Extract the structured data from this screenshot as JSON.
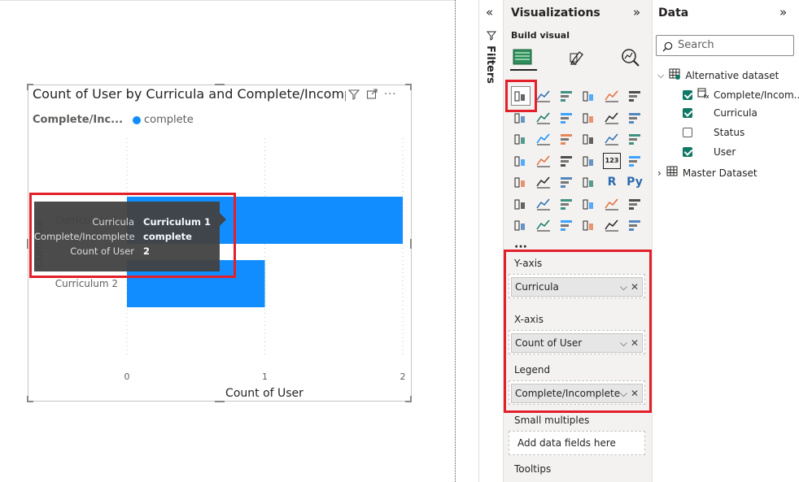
{
  "visual": {
    "title": "Count of User by Curricula and Complete/Incomplete",
    "legend_title": "Complete/Inc...",
    "legend_item": "complete",
    "icons": [
      "filter-icon",
      "focus-mode-icon",
      "more-options-icon"
    ]
  },
  "chart_data": {
    "type": "bar",
    "orientation": "horizontal",
    "title": "Count of User by Curricula and Complete/Incomplete",
    "ylabel": "Curricula",
    "xlabel": "Count of User",
    "categories": [
      "Curriculum 1",
      "Curriculum 2"
    ],
    "series": [
      {
        "name": "complete",
        "values": [
          2,
          1
        ],
        "color": "#118dff"
      }
    ],
    "xticks": [
      "0",
      "1",
      "2"
    ],
    "xlim": [
      0,
      2
    ],
    "grid": true,
    "legend": "top-left"
  },
  "tooltip": {
    "rows": [
      {
        "key": "Curricula",
        "value": "Curriculum 1"
      },
      {
        "key": "Complete/Incomplete",
        "value": "complete"
      },
      {
        "key": "Count of User",
        "value": "2"
      }
    ]
  },
  "filters": {
    "label": "Filters"
  },
  "visualizations": {
    "title": "Visualizations",
    "build_label": "Build visual",
    "more": "···",
    "wells": {
      "y_axis": {
        "label": "Y-axis",
        "field": "Curricula"
      },
      "x_axis": {
        "label": "X-axis",
        "field": "Count of User"
      },
      "legend": {
        "label": "Legend",
        "field": "Complete/Incomplete"
      },
      "small_multiples": {
        "label": "Small multiples",
        "placeholder": "Add data fields here"
      },
      "tooltips": {
        "label": "Tooltips"
      }
    }
  },
  "data_pane": {
    "title": "Data",
    "search_placeholder": "Search",
    "tables": [
      {
        "name": "Alternative dataset",
        "expanded": true,
        "fields": [
          {
            "name": "Complete/Incom...",
            "checked": true
          },
          {
            "name": "Curricula",
            "checked": true
          },
          {
            "name": "Status",
            "checked": false
          },
          {
            "name": "User",
            "checked": true
          }
        ]
      },
      {
        "name": "Master Dataset",
        "expanded": false,
        "fields": []
      }
    ]
  },
  "colors": {
    "accent": "#118dff",
    "highlight": "#e3202a",
    "check": "#117865"
  }
}
